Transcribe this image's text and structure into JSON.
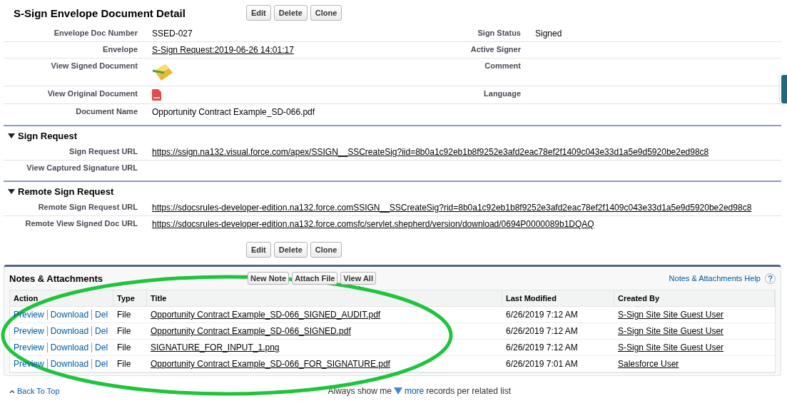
{
  "title": "S-Sign Envelope Document Detail",
  "top_buttons": [
    "Edit",
    "Delete",
    "Clone"
  ],
  "detail_rows": [
    {
      "left": {
        "label": "Envelope Doc Number",
        "kind": "text",
        "value": "SSED-027"
      },
      "right": {
        "label": "Sign Status",
        "kind": "text",
        "value": "Signed"
      }
    },
    {
      "left": {
        "label": "Envelope",
        "kind": "link",
        "value": "S-Sign Request:2019-06-26 14:01:17"
      },
      "right": {
        "label": "Active Signer",
        "kind": "empty"
      }
    },
    {
      "left": {
        "label": "View Signed Document",
        "kind": "signed_icon"
      },
      "right": {
        "label": "Comment",
        "kind": "empty"
      }
    },
    {
      "left": {
        "label": "View Original Document",
        "kind": "pdf_icon"
      },
      "right": {
        "label": "Language",
        "kind": "empty"
      }
    },
    {
      "left": {
        "label": "Document Name",
        "kind": "text",
        "value": "Opportunity Contract Example_SD-066.pdf"
      }
    }
  ],
  "sections": [
    {
      "title": "Sign Request",
      "expanded": true,
      "fields": [
        {
          "label": "Sign Request URL",
          "kind": "link",
          "value": "https://ssign.na132.visual.force.com/apex/SSIGN__SSCreateSig?iid=8b0a1c92eb1b8f9252e3afd2eac78ef2f1409c043e33d1a5e9d5920be2ed98c8"
        },
        {
          "label": "View Captured Signature URL",
          "kind": "empty"
        }
      ]
    },
    {
      "title": "Remote Sign Request",
      "expanded": true,
      "fields": [
        {
          "label": "Remote Sign Request URL",
          "kind": "link",
          "value": "https://sdocsrules-developer-edition.na132.force.comSSIGN__SSCreateSig?rid=8b0a1c92eb1b8f9252e3afd2eac78ef2f1409c043e33d1a5e9d5920be2ed98c8"
        },
        {
          "label": "Remote View Signed Doc URL",
          "kind": "link",
          "value": "https://sdocsrules-developer-edition.na132.force.comsfc/servlet.shepherd/version/download/0694P0000089b1DQAQ"
        }
      ]
    }
  ],
  "bottom_buttons": [
    "Edit",
    "Delete",
    "Clone"
  ],
  "notes": {
    "title": "Notes & Attachments",
    "buttons": [
      "New Note",
      "Attach File",
      "View All"
    ],
    "help_link": "Notes & Attachments Help",
    "columns": [
      "Action",
      "Type",
      "Title",
      "Last Modified",
      "Created By"
    ],
    "rows": [
      {
        "actions": [
          "Preview",
          "Download",
          "Del"
        ],
        "type": "File",
        "title": "Opportunity Contract Example_SD-066_SIGNED_AUDIT.pdf",
        "last_modified": "6/26/2019 7:12 AM",
        "created_by": "S-Sign Site Site Guest User"
      },
      {
        "actions": [
          "Preview",
          "Download",
          "Del"
        ],
        "type": "File",
        "title": "Opportunity Contract Example_SD-066_SIGNED.pdf",
        "last_modified": "6/26/2019 7:12 AM",
        "created_by": "S-Sign Site Site Guest User"
      },
      {
        "actions": [
          "Preview",
          "Download",
          "Del"
        ],
        "type": "File",
        "title": "SIGNATURE_FOR_INPUT_1.png",
        "last_modified": "6/26/2019 7:12 AM",
        "created_by": "S-Sign Site Site Guest User"
      },
      {
        "actions": [
          "Preview",
          "Download",
          "Del"
        ],
        "type": "File",
        "title": "Opportunity Contract Example_SD-066_FOR_SIGNATURE.pdf",
        "last_modified": "6/26/2019 7:01 AM",
        "created_by": "Salesforce User"
      }
    ]
  },
  "footer": {
    "back_to_top": "Back To Top",
    "show_prefix": "Always show me",
    "more": "more",
    "show_suffix": "records per related list"
  }
}
